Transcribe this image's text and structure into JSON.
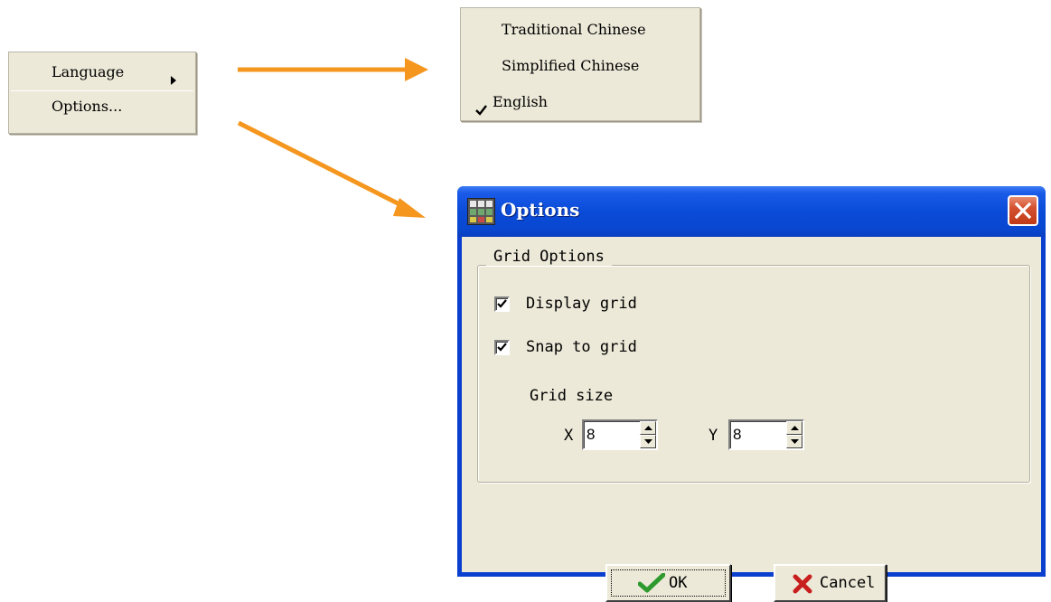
{
  "context_menu": {
    "items": [
      {
        "label": "Language"
      },
      {
        "label": "Options..."
      }
    ]
  },
  "language_submenu": {
    "items": [
      {
        "label": "Traditional Chinese",
        "checked": false
      },
      {
        "label": "Simplified Chinese",
        "checked": false
      },
      {
        "label": "English",
        "checked": true
      }
    ]
  },
  "options_dialog": {
    "title": "Options",
    "group_title": "Grid Options",
    "display_grid": {
      "label": "Display grid",
      "checked": true
    },
    "snap_to_grid": {
      "label": "Snap to grid",
      "checked": true
    },
    "grid_size_label": "Grid size",
    "x_label": "X",
    "x_value": "8",
    "y_label": "Y",
    "y_value": "8",
    "ok_label": "OK",
    "cancel_label": "Cancel"
  },
  "colors": {
    "arrow": "#f5961e",
    "menu_bg": "#ece9d8",
    "titlebar": "#0a4bd8",
    "close_button": "#d4502e",
    "ok_check": "#2e9a2e",
    "cancel_x": "#c81e1e"
  },
  "icons": {
    "submenu_arrow": "submenu-arrow-icon",
    "check": "checkmark-icon",
    "app": "app-grid-icon",
    "close": "close-icon",
    "ok": "ok-check-icon",
    "cancel": "cancel-x-icon"
  }
}
